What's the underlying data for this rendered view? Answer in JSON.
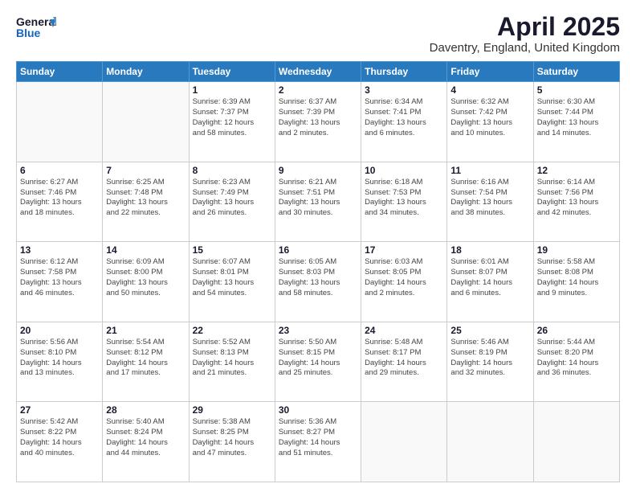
{
  "header": {
    "logo_line1": "General",
    "logo_line2": "Blue",
    "title": "April 2025",
    "subtitle": "Daventry, England, United Kingdom"
  },
  "weekdays": [
    "Sunday",
    "Monday",
    "Tuesday",
    "Wednesday",
    "Thursday",
    "Friday",
    "Saturday"
  ],
  "weeks": [
    [
      {
        "day": "",
        "info": ""
      },
      {
        "day": "",
        "info": ""
      },
      {
        "day": "1",
        "info": "Sunrise: 6:39 AM\nSunset: 7:37 PM\nDaylight: 12 hours\nand 58 minutes."
      },
      {
        "day": "2",
        "info": "Sunrise: 6:37 AM\nSunset: 7:39 PM\nDaylight: 13 hours\nand 2 minutes."
      },
      {
        "day": "3",
        "info": "Sunrise: 6:34 AM\nSunset: 7:41 PM\nDaylight: 13 hours\nand 6 minutes."
      },
      {
        "day": "4",
        "info": "Sunrise: 6:32 AM\nSunset: 7:42 PM\nDaylight: 13 hours\nand 10 minutes."
      },
      {
        "day": "5",
        "info": "Sunrise: 6:30 AM\nSunset: 7:44 PM\nDaylight: 13 hours\nand 14 minutes."
      }
    ],
    [
      {
        "day": "6",
        "info": "Sunrise: 6:27 AM\nSunset: 7:46 PM\nDaylight: 13 hours\nand 18 minutes."
      },
      {
        "day": "7",
        "info": "Sunrise: 6:25 AM\nSunset: 7:48 PM\nDaylight: 13 hours\nand 22 minutes."
      },
      {
        "day": "8",
        "info": "Sunrise: 6:23 AM\nSunset: 7:49 PM\nDaylight: 13 hours\nand 26 minutes."
      },
      {
        "day": "9",
        "info": "Sunrise: 6:21 AM\nSunset: 7:51 PM\nDaylight: 13 hours\nand 30 minutes."
      },
      {
        "day": "10",
        "info": "Sunrise: 6:18 AM\nSunset: 7:53 PM\nDaylight: 13 hours\nand 34 minutes."
      },
      {
        "day": "11",
        "info": "Sunrise: 6:16 AM\nSunset: 7:54 PM\nDaylight: 13 hours\nand 38 minutes."
      },
      {
        "day": "12",
        "info": "Sunrise: 6:14 AM\nSunset: 7:56 PM\nDaylight: 13 hours\nand 42 minutes."
      }
    ],
    [
      {
        "day": "13",
        "info": "Sunrise: 6:12 AM\nSunset: 7:58 PM\nDaylight: 13 hours\nand 46 minutes."
      },
      {
        "day": "14",
        "info": "Sunrise: 6:09 AM\nSunset: 8:00 PM\nDaylight: 13 hours\nand 50 minutes."
      },
      {
        "day": "15",
        "info": "Sunrise: 6:07 AM\nSunset: 8:01 PM\nDaylight: 13 hours\nand 54 minutes."
      },
      {
        "day": "16",
        "info": "Sunrise: 6:05 AM\nSunset: 8:03 PM\nDaylight: 13 hours\nand 58 minutes."
      },
      {
        "day": "17",
        "info": "Sunrise: 6:03 AM\nSunset: 8:05 PM\nDaylight: 14 hours\nand 2 minutes."
      },
      {
        "day": "18",
        "info": "Sunrise: 6:01 AM\nSunset: 8:07 PM\nDaylight: 14 hours\nand 6 minutes."
      },
      {
        "day": "19",
        "info": "Sunrise: 5:58 AM\nSunset: 8:08 PM\nDaylight: 14 hours\nand 9 minutes."
      }
    ],
    [
      {
        "day": "20",
        "info": "Sunrise: 5:56 AM\nSunset: 8:10 PM\nDaylight: 14 hours\nand 13 minutes."
      },
      {
        "day": "21",
        "info": "Sunrise: 5:54 AM\nSunset: 8:12 PM\nDaylight: 14 hours\nand 17 minutes."
      },
      {
        "day": "22",
        "info": "Sunrise: 5:52 AM\nSunset: 8:13 PM\nDaylight: 14 hours\nand 21 minutes."
      },
      {
        "day": "23",
        "info": "Sunrise: 5:50 AM\nSunset: 8:15 PM\nDaylight: 14 hours\nand 25 minutes."
      },
      {
        "day": "24",
        "info": "Sunrise: 5:48 AM\nSunset: 8:17 PM\nDaylight: 14 hours\nand 29 minutes."
      },
      {
        "day": "25",
        "info": "Sunrise: 5:46 AM\nSunset: 8:19 PM\nDaylight: 14 hours\nand 32 minutes."
      },
      {
        "day": "26",
        "info": "Sunrise: 5:44 AM\nSunset: 8:20 PM\nDaylight: 14 hours\nand 36 minutes."
      }
    ],
    [
      {
        "day": "27",
        "info": "Sunrise: 5:42 AM\nSunset: 8:22 PM\nDaylight: 14 hours\nand 40 minutes."
      },
      {
        "day": "28",
        "info": "Sunrise: 5:40 AM\nSunset: 8:24 PM\nDaylight: 14 hours\nand 44 minutes."
      },
      {
        "day": "29",
        "info": "Sunrise: 5:38 AM\nSunset: 8:25 PM\nDaylight: 14 hours\nand 47 minutes."
      },
      {
        "day": "30",
        "info": "Sunrise: 5:36 AM\nSunset: 8:27 PM\nDaylight: 14 hours\nand 51 minutes."
      },
      {
        "day": "",
        "info": ""
      },
      {
        "day": "",
        "info": ""
      },
      {
        "day": "",
        "info": ""
      }
    ]
  ]
}
